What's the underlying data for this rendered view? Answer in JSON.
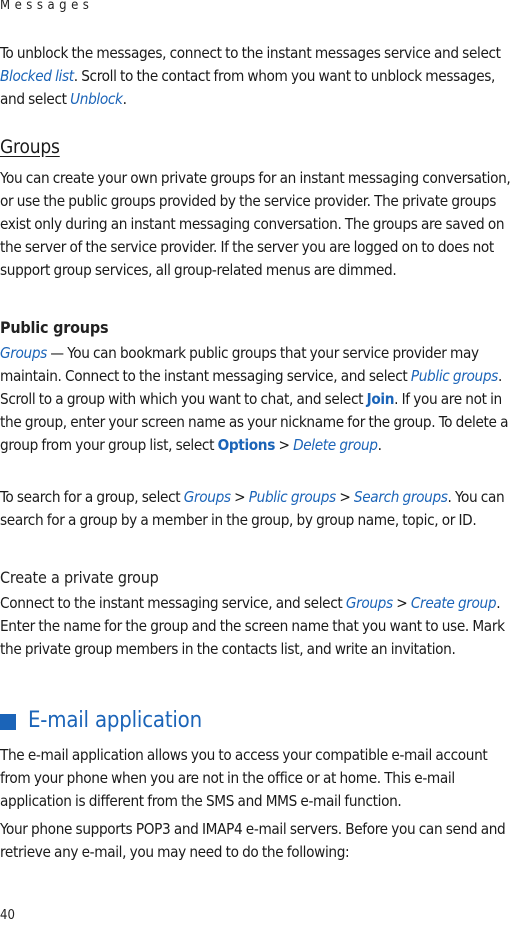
{
  "header": {
    "section_title": "Messages"
  },
  "intro": {
    "t1": "To unblock the messages, connect to the instant messages service and select ",
    "link1": "Blocked list",
    "t2": ". Scroll to the contact from whom you want to unblock messages, and select ",
    "link2": "Unblock",
    "t3": "."
  },
  "groups": {
    "heading": "Groups",
    "body": "You can create your own private groups for an instant messaging conversation, or use the public groups provided by the service provider. The private groups exist only during an instant messaging conversation. The groups are saved on the server of the service provider. If the server you are logged on to does not support group services, all group-related menus are dimmed."
  },
  "public_groups": {
    "heading": "Public groups",
    "link1": "Groups",
    "t1": " — You can bookmark public groups that your service provider may maintain. Connect to the instant messaging service, and select ",
    "link2": "Public groups",
    "t2": ". Scroll to a group with which you want to chat, and select ",
    "key1": "Join",
    "t3": ". If you are not in the group, enter your screen name as your nickname for the group. To delete a group from your group list, select ",
    "key2": "Options",
    "sep": " > ",
    "link3": "Delete group",
    "t4": "."
  },
  "search": {
    "t1": "To search for a group, select ",
    "link1": "Groups",
    "sep": " > ",
    "link2": "Public groups",
    "link3": "Search groups",
    "t2": ". You can search for a group by a member in the group, by group name, topic, or ID."
  },
  "create_group": {
    "heading": "Create a private group",
    "t1": "Connect to the instant messaging service, and select ",
    "link1": "Groups",
    "sep": " > ",
    "link2": "Create group",
    "t2": ". Enter the name for the group and the screen name that you want to use. Mark the private group members in the contacts list, and write an invitation."
  },
  "email": {
    "heading": "E-mail application",
    "p1": "The e-mail application allows you to access your compatible e-mail account from your phone when you are not in the office or at home. This e-mail application is different from the SMS and MMS e-mail function.",
    "p2": "Your phone supports POP3 and IMAP4 e-mail servers. Before you can send and retrieve any e-mail, you may need to do the following:"
  },
  "footer": {
    "page_number": "40"
  },
  "colors": {
    "accent": "#1b64b8",
    "text": "#1a1a1a"
  }
}
